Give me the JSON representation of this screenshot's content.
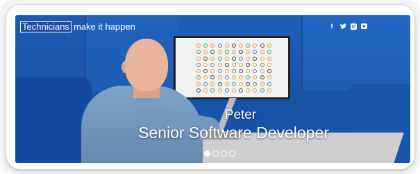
{
  "brand": {
    "logo_text": "Technicians",
    "tagline": "make it happen"
  },
  "social": [
    {
      "icon": "facebook-icon",
      "glyph": "f"
    },
    {
      "icon": "twitter-icon",
      "glyph": "𝕥"
    },
    {
      "icon": "instagram-icon",
      "glyph": ""
    },
    {
      "icon": "youtube-icon",
      "glyph": ""
    }
  ],
  "slide": {
    "name": "Peter",
    "role": "Senior Software Developer"
  },
  "pager": {
    "total": 4,
    "active_index": 0
  },
  "colors": {
    "brand_blue": "#1a4fa3",
    "background_blue": "#1a56ad",
    "text": "#ffffff"
  }
}
